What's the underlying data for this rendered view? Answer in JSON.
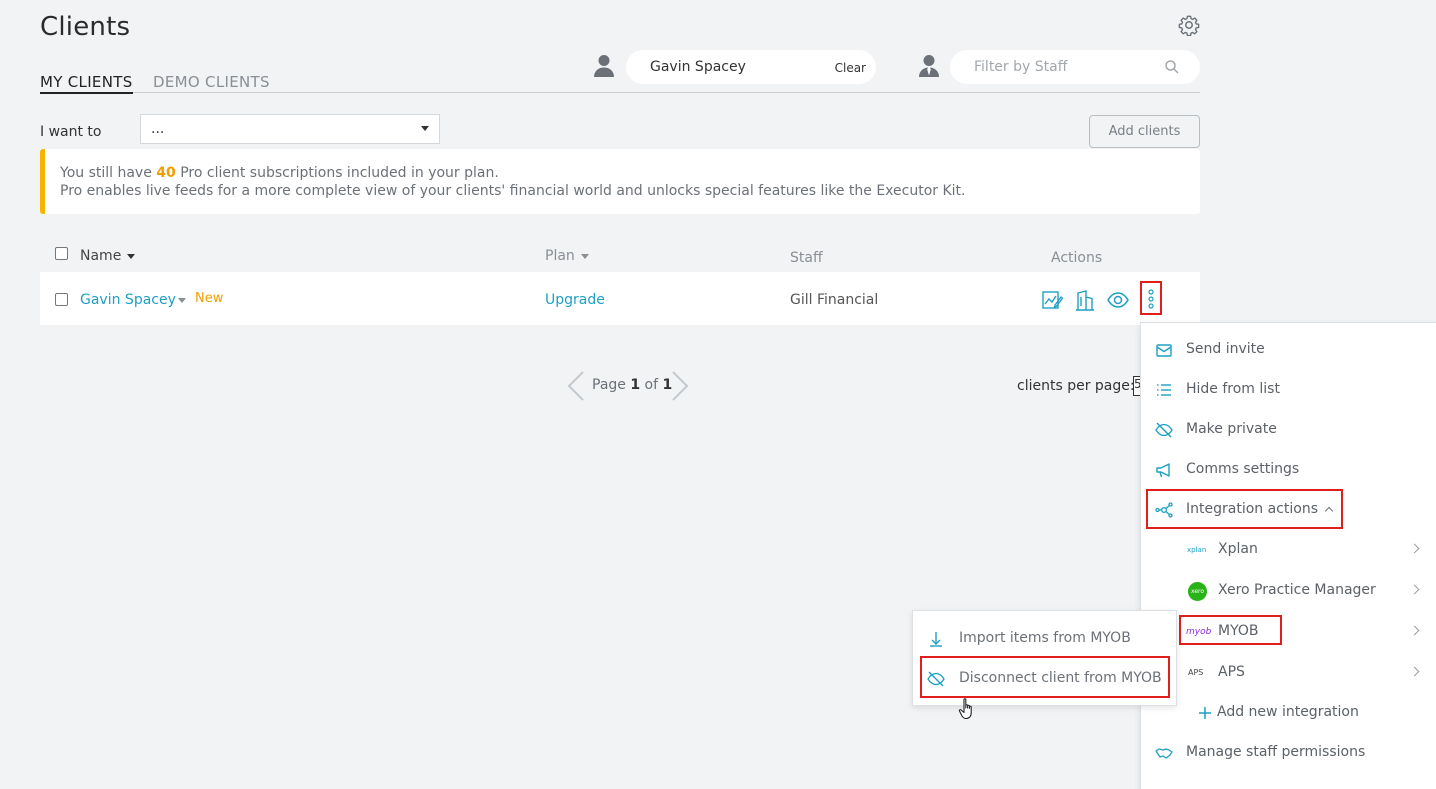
{
  "page": {
    "title": "Clients"
  },
  "tabs": [
    {
      "label": "MY CLIENTS",
      "active": true
    },
    {
      "label": "DEMO CLIENTS",
      "active": false
    }
  ],
  "client_filter": {
    "value": "Gavin Spacey",
    "clear_label": "Clear"
  },
  "staff_filter": {
    "placeholder": "Filter by Staff"
  },
  "iwant": {
    "label": "I want to",
    "value": "..."
  },
  "add_clients_label": "Add clients",
  "banner": {
    "line1_pre": "You still have ",
    "count": "40",
    "line1_post": " Pro client subscriptions included in your plan.",
    "line2": "Pro enables live feeds for a more complete view of your clients' financial world and unlocks special features like the Executor Kit.",
    "accent_color": "#f4b400"
  },
  "table": {
    "headers": {
      "name": "Name",
      "plan": "Plan",
      "staff": "Staff",
      "actions": "Actions"
    },
    "rows": [
      {
        "name": "Gavin Spacey",
        "badge": "New",
        "plan": "Upgrade",
        "staff": "Gill Financial"
      }
    ]
  },
  "pagination": {
    "prefix": "Page ",
    "current": "1",
    "of": " of ",
    "total": "1",
    "per_page_label": "clients per page:",
    "per_page_value": "5"
  },
  "menu": {
    "items": [
      {
        "label": "Send invite",
        "icon": "envelope-icon"
      },
      {
        "label": "Hide from list",
        "icon": "list-icon"
      },
      {
        "label": "Make private",
        "icon": "eye-off-icon"
      },
      {
        "label": "Comms settings",
        "icon": "megaphone-icon"
      },
      {
        "label": "Integration actions",
        "icon": "network-icon"
      },
      {
        "label": "Xplan",
        "icon": "xplan-logo-icon"
      },
      {
        "label": "Xero Practice Manager",
        "icon": "xero-logo-icon"
      },
      {
        "label": "MYOB",
        "icon": "myob-logo-icon"
      },
      {
        "label": "APS",
        "icon": "aps-logo-icon"
      },
      {
        "label": "Add new integration",
        "icon": "plus-icon"
      },
      {
        "label": "Manage staff permissions",
        "icon": "handshake-icon"
      }
    ],
    "xero_logo_text": "xero",
    "myob_logo_text": "myob",
    "aps_logo_text": "APS",
    "xplan_logo_text": "xplan"
  },
  "submenu": {
    "items": [
      {
        "label": "Import items from MYOB",
        "icon": "import-icon"
      },
      {
        "label": "Disconnect client from MYOB",
        "icon": "eye-slash-icon"
      }
    ]
  },
  "colors": {
    "link": "#1e9fc4",
    "highlight": "#e01e1e",
    "new_badge": "#f29d00"
  }
}
